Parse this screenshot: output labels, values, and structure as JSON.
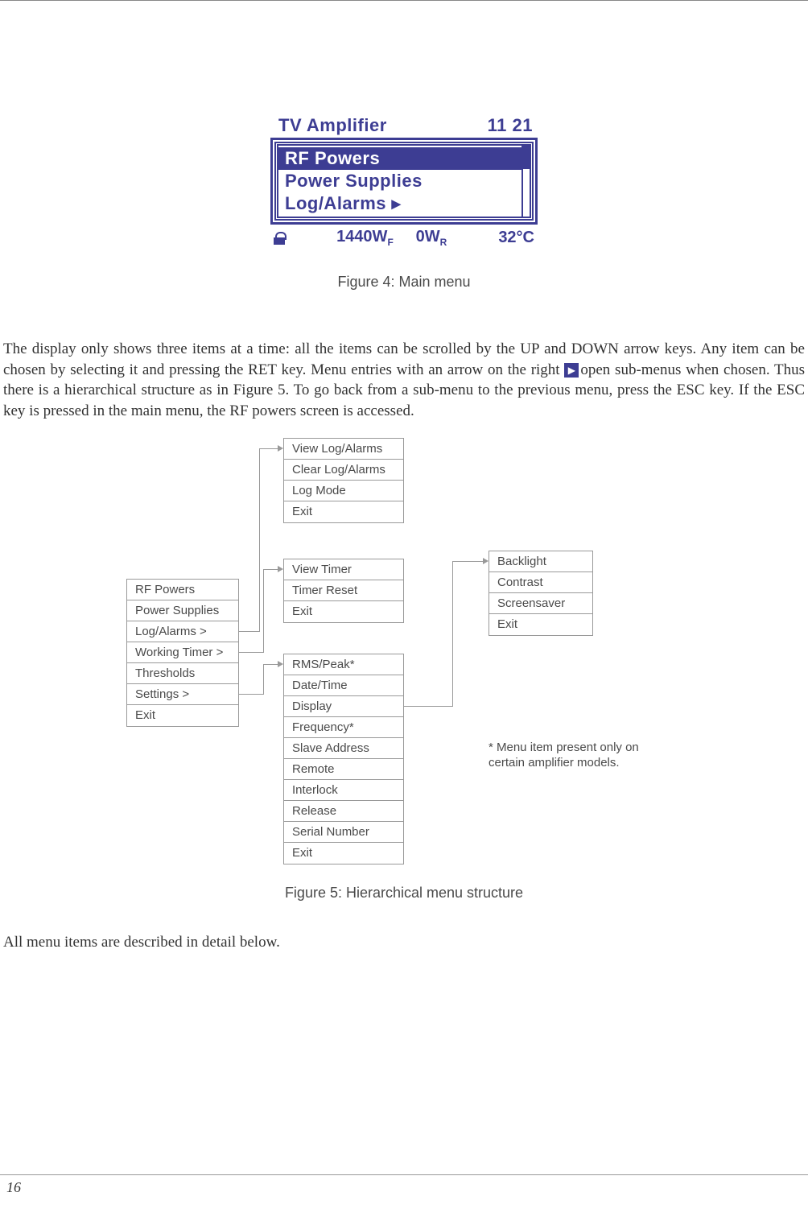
{
  "lcd": {
    "header_title": "TV Amplifier",
    "header_time": "11 21",
    "items": [
      "RF Powers",
      "Power Supplies",
      "Log/Alarms ▸"
    ],
    "footer_wf": "1440W",
    "footer_wf_sub": "F",
    "footer_wr": "0W",
    "footer_wr_sub": "R",
    "footer_temp": "32°C"
  },
  "figure4_caption": "Figure 4: Main menu",
  "paragraph1": "The display only shows three items at a time: all the items can be scrolled by the UP and DOWN arrow keys. Any item can be chosen by selecting it and pressing the RET key. Menu entries with an arrow on the right ",
  "paragraph1b": "open sub-menus when chosen. Thus there is a hierarchical structure as in Figure 5. To go back from a sub-menu to the previous menu, press the ESC key. If the ESC key is pressed in the main menu, the RF powers screen is accessed.",
  "main_menu": [
    "RF Powers",
    "Power Supplies",
    "Log/Alarms >",
    "Working Timer >",
    "Thresholds",
    "Settings >",
    "Exit"
  ],
  "log_menu": [
    "View Log/Alarms",
    "Clear Log/Alarms",
    "Log Mode",
    "Exit"
  ],
  "timer_menu": [
    "View Timer",
    "Timer Reset",
    "Exit"
  ],
  "settings_menu": [
    "RMS/Peak*",
    "Date/Time",
    "Display",
    "Frequency*",
    "Slave Address",
    "Remote",
    "Interlock",
    "Release",
    "Serial Number",
    "Exit"
  ],
  "display_menu": [
    "Backlight",
    "Contrast",
    "Screensaver",
    "Exit"
  ],
  "footnote": "* Menu item present only on certain amplifier models.",
  "figure5_caption": "Figure 5: Hierarchical menu structure",
  "closing": "All menu items are described in detail below.",
  "page_number": "16"
}
